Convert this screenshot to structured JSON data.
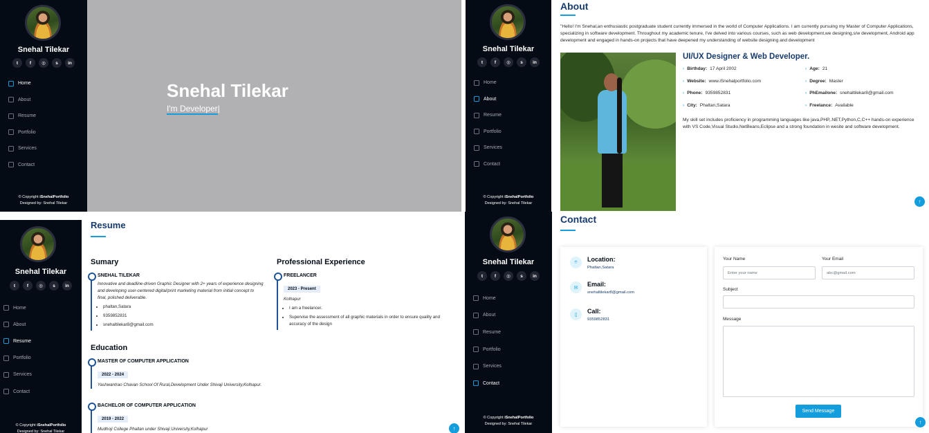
{
  "profile": {
    "name": "Snehal Tilekar",
    "socials": [
      {
        "icon": "twitter-icon",
        "glyph": "t"
      },
      {
        "icon": "facebook-icon",
        "glyph": "f"
      },
      {
        "icon": "instagram-icon",
        "glyph": "◎"
      },
      {
        "icon": "skype-icon",
        "glyph": "s"
      },
      {
        "icon": "linkedin-icon",
        "glyph": "in"
      }
    ]
  },
  "nav": [
    {
      "label": "Home",
      "icon": "home-icon"
    },
    {
      "label": "About",
      "icon": "person-icon"
    },
    {
      "label": "Resume",
      "icon": "file-icon"
    },
    {
      "label": "Portfolio",
      "icon": "book-icon"
    },
    {
      "label": "Services",
      "icon": "server-icon"
    },
    {
      "label": "Contact",
      "icon": "envelope-icon"
    }
  ],
  "footer": {
    "copyright_prefix": "© Copyright",
    "brand": "iSnehalPortfolio",
    "designed": "Designed by: Snehal Tilekar"
  },
  "hero": {
    "name": "Snehal Tilekar",
    "prefix": "I'm ",
    "typed": "Developer",
    "cursor": "|"
  },
  "about": {
    "title": "About",
    "paragraph": "\"Hello! I'm Snehal,an enthusiastic postgraduate student currently immersed in the world of Computer Applications. I am currently pursuing my Master of Computer Applications, specializing in software development. Throughout my academic tenure, I've delved into various courses, such as web development,we designing,s/w development, Android app development and engaged in hands-on projects that have deepened my understanding of website designing and development",
    "heading": "UI/UX Designer & Web Developer.",
    "facts": [
      {
        "label": "Birthday:",
        "value": "17 April 2002"
      },
      {
        "label": "Age:",
        "value": "21"
      },
      {
        "label": "Website:",
        "value": "www.iSnehalportfolio.com"
      },
      {
        "label": "Degree:",
        "value": "Master"
      },
      {
        "label": "Phone:",
        "value": "9359852831"
      },
      {
        "label": "PhEmailone:",
        "value": "snehaltilekar8@gmail.com"
      },
      {
        "label": "City:",
        "value": "Phaltan,Satara"
      },
      {
        "label": "Freelance:",
        "value": "Available"
      }
    ],
    "skills": "My skill set includes proficiency in programming languages like java,PHP,.NET,Python,C,C++ hands-on experience with VS Code,Visual Studio,NetBeans,Eclipse and a strong foundation in wesite and software development."
  },
  "resume": {
    "title": "Resume",
    "summary_title": "Sumary",
    "summary": {
      "name": "SNEHAL TILEKAR",
      "desc": "Innovative and deadline-driven Graphic Designer with 2+ years of experience designing and developing user-centered digital/print marketing material from initial concept to final, polished deliverable.",
      "items": [
        "phaltan,Satara",
        "9359852831",
        "snehaltilekar8@gmail.com"
      ]
    },
    "education_title": "Education",
    "education": [
      {
        "degree": "MASTER OF COMPUTER APPLICATION",
        "years": "2022 - 2024",
        "school": "Yashwantrao Chavan School Of Rural,Development Under Shivaji University,Kolhapur."
      },
      {
        "degree": "BACHELOR OF COMPUTER APPLICATION",
        "years": "2019 - 2022",
        "school": "Mudhoji College Phaltan under Shivaji University,Kolhapur"
      }
    ],
    "experience_title": "Professional Experience",
    "experience": {
      "role": "FREELANCER",
      "years": "2023 - Present",
      "place": "Kolhapur",
      "points": [
        "I am a freelancer.",
        "Supervise the assessment of all graphic materials in order to ensure quality and accuracy of the design"
      ]
    }
  },
  "contact": {
    "title": "Contact",
    "location": {
      "label": "Location:",
      "value": "Phaltan,Satara"
    },
    "email": {
      "label": "Email:",
      "value": "snehaltilekar8@gmail.com"
    },
    "call": {
      "label": "Call:",
      "value": "9359852831"
    },
    "form": {
      "name_label": "Your Name",
      "name_placeholder": "Enter your name",
      "email_label": "Your Email",
      "email_placeholder": "abc@gmail.com",
      "subject_label": "Subject",
      "message_label": "Message",
      "send": "Send Message"
    }
  },
  "colors": {
    "accent": "#149ddd",
    "sidebar": "#040b14",
    "heading": "#173b6c"
  }
}
